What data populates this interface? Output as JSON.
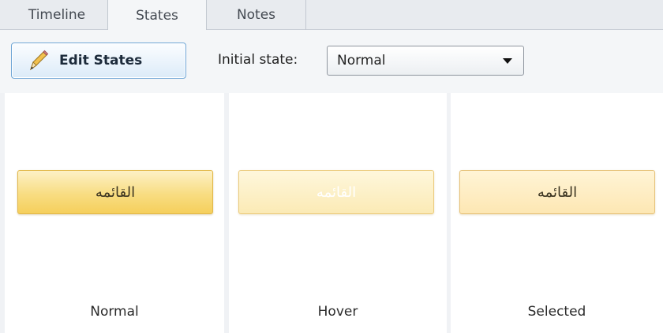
{
  "tabs": [
    {
      "label": "Timeline",
      "active": false
    },
    {
      "label": "States",
      "active": true
    },
    {
      "label": "Notes",
      "active": false
    }
  ],
  "toolbar": {
    "edit_states_label": "Edit States",
    "initial_state_label": "Initial state:",
    "initial_state_value": "Normal"
  },
  "states": [
    {
      "name": "Normal",
      "button_text": "القائمه"
    },
    {
      "name": "Hover",
      "button_text": "القائمه"
    },
    {
      "name": "Selected",
      "button_text": "القائمه"
    }
  ],
  "icons": {
    "edit": "pencil-icon",
    "dropdown": "chevron-down-icon"
  },
  "colors": {
    "accent_border": "#6fa6d6",
    "button_gold": "#f8dd82"
  }
}
